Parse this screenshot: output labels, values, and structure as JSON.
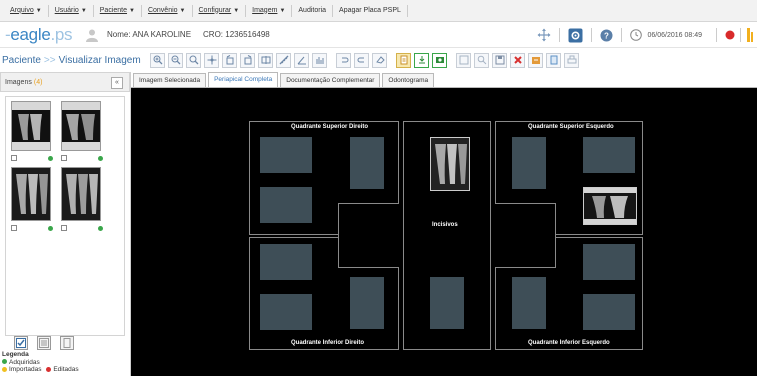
{
  "menu": [
    {
      "label": "Arquivo",
      "has_caret": true
    },
    {
      "label": "Usuário",
      "has_caret": true
    },
    {
      "label": "Paciente",
      "has_caret": true
    },
    {
      "label": "Convênio",
      "has_caret": true
    },
    {
      "label": "Configurar",
      "has_caret": true
    },
    {
      "label": "Imagem",
      "has_caret": true
    },
    {
      "label": "Auditoria",
      "has_caret": false
    },
    {
      "label": "Apagar Placa PSPL",
      "has_caret": false
    }
  ],
  "header": {
    "logo_text": "eagle",
    "logo_suffix": ".ps",
    "patient_label": "Nome:",
    "patient_name": "ANA KAROLINE",
    "cro_label": "CRO:",
    "cro_value": "1236516498",
    "datetime": "06/06/2016 08:49"
  },
  "breadcrumb": {
    "root": "Paciente",
    "separator": ">>",
    "current": "Visualizar Imagem"
  },
  "sidebar": {
    "title": "Imagens",
    "count": "(4)",
    "legend_title": "Legenda",
    "legend_items": [
      {
        "label": "Adquiridas",
        "color": "#3aa64a"
      },
      {
        "label": "Importadas",
        "color": "#f0c020"
      },
      {
        "label": "Editadas",
        "color": "#d83030"
      }
    ]
  },
  "tabs": [
    {
      "label": "Imagem Selecionada",
      "active": false
    },
    {
      "label": "Periapical Completa",
      "active": true
    },
    {
      "label": "Documentação Complementar",
      "active": false
    },
    {
      "label": "Odontograma",
      "active": false
    }
  ],
  "viewer": {
    "q_sup_dir": "Quadrante Superior Direito",
    "q_sup_esq": "Quadrante Superior Esquerdo",
    "incisivos": "Incisivos",
    "q_inf_dir": "Quadrante Inferior Direito",
    "q_inf_esq": "Quadrante Inferior Esquerdo"
  },
  "colors": {
    "accent": "#3b86c4",
    "slot": "#3e4e57",
    "background": "#000000",
    "status_green": "#3aa64a"
  }
}
